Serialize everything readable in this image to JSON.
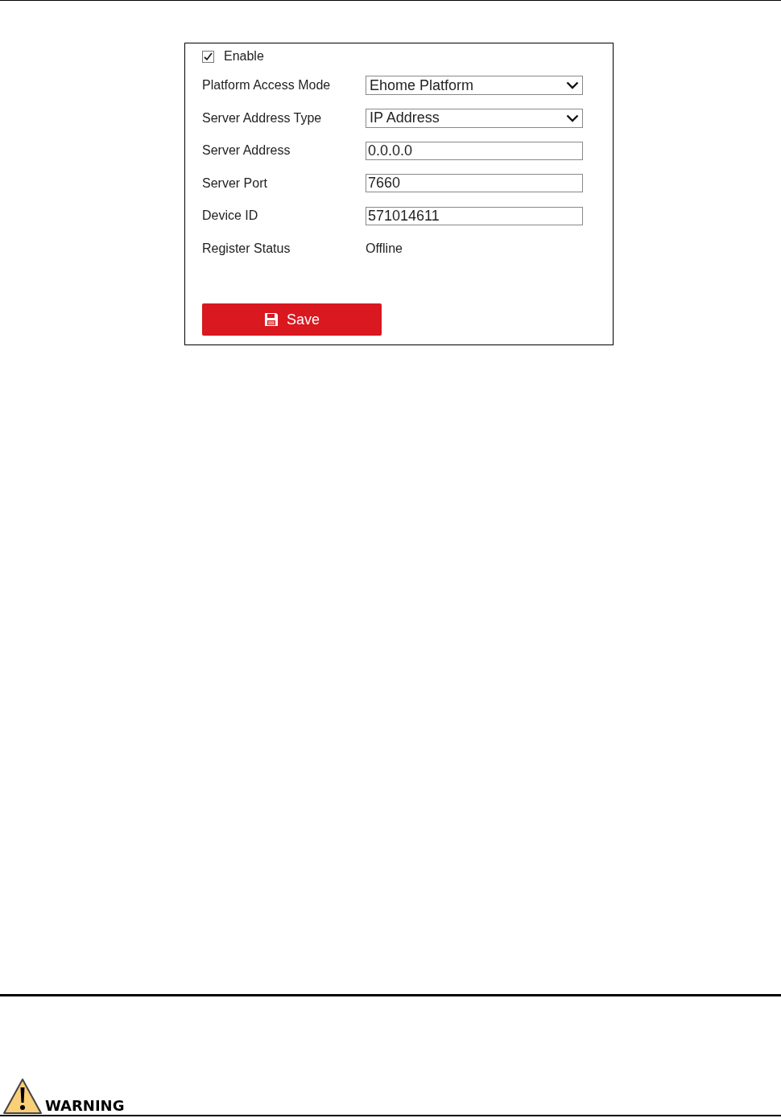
{
  "enable": {
    "label": "Enable",
    "checked": true
  },
  "fields": [
    {
      "kind": "select",
      "label": "Platform Access Mode",
      "value": "Ehome Platform"
    },
    {
      "kind": "select",
      "label": "Server Address Type",
      "value": "IP Address"
    },
    {
      "kind": "text",
      "label": "Server Address",
      "value": "0.0.0.0"
    },
    {
      "kind": "text",
      "label": "Server Port",
      "value": "7660"
    },
    {
      "kind": "text",
      "label": "Device ID",
      "value": "571014611"
    },
    {
      "kind": "status",
      "label": "Register Status",
      "value": "Offline"
    }
  ],
  "save_button": {
    "label": "Save"
  },
  "warning": {
    "title": "WARNING"
  }
}
